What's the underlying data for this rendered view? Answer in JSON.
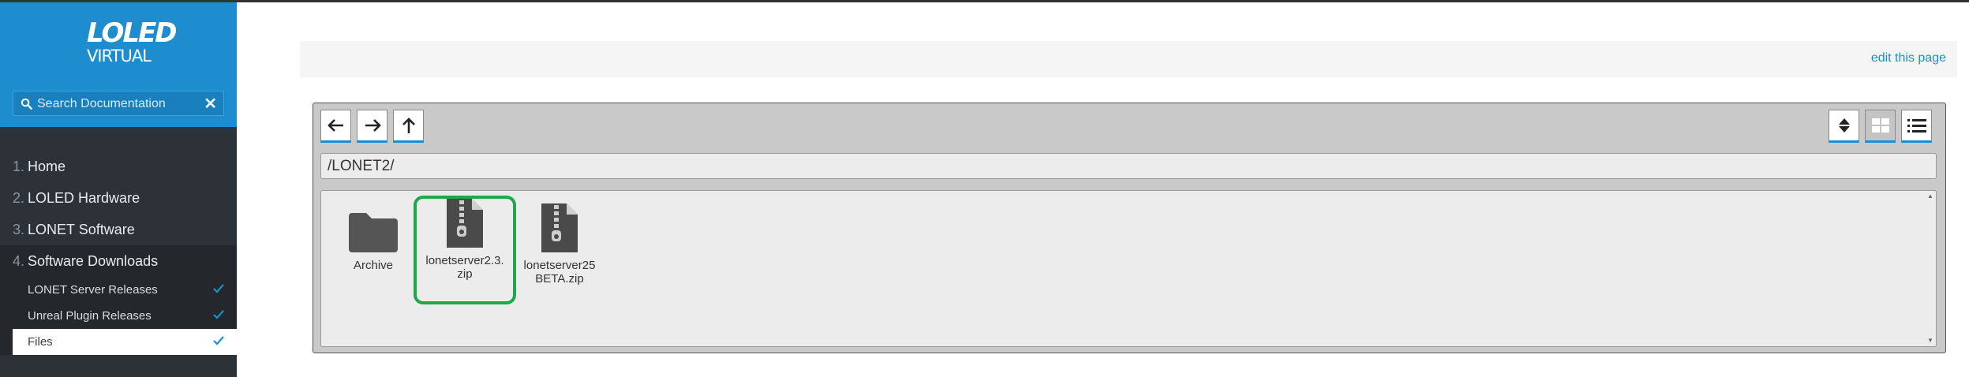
{
  "brand": {
    "line1": "LOLED",
    "line2": "VIRTUAL"
  },
  "search": {
    "placeholder": "Search Documentation",
    "clear_label": "✕"
  },
  "nav": {
    "items": [
      {
        "num": "1.",
        "label": "Home"
      },
      {
        "num": "2.",
        "label": "LOLED Hardware"
      },
      {
        "num": "3.",
        "label": "LONET Software"
      },
      {
        "num": "4.",
        "label": "Software Downloads"
      }
    ],
    "subitems": [
      {
        "label": "LONET Server Releases"
      },
      {
        "label": "Unreal Plugin Releases"
      },
      {
        "label": "Files"
      }
    ]
  },
  "edit_link": "edit this page",
  "file_manager": {
    "path": "/LONET2/",
    "files": [
      {
        "name": "Archive",
        "type": "folder"
      },
      {
        "name": "lonetserver2.3.zip",
        "type": "zip",
        "selected": true
      },
      {
        "name": "lonetserver25BETA.zip",
        "type": "zip"
      }
    ],
    "labels": {
      "archive": "Archive",
      "file1_line1": "lonetserver2.3.",
      "file1_line2": "zip",
      "file2_line1": "lonetserver25",
      "file2_line2": "BETA.zip"
    }
  },
  "colors": {
    "accent": "#1d8dd0",
    "sidebar_bg": "#2d3238",
    "selection": "#1fa84a"
  }
}
